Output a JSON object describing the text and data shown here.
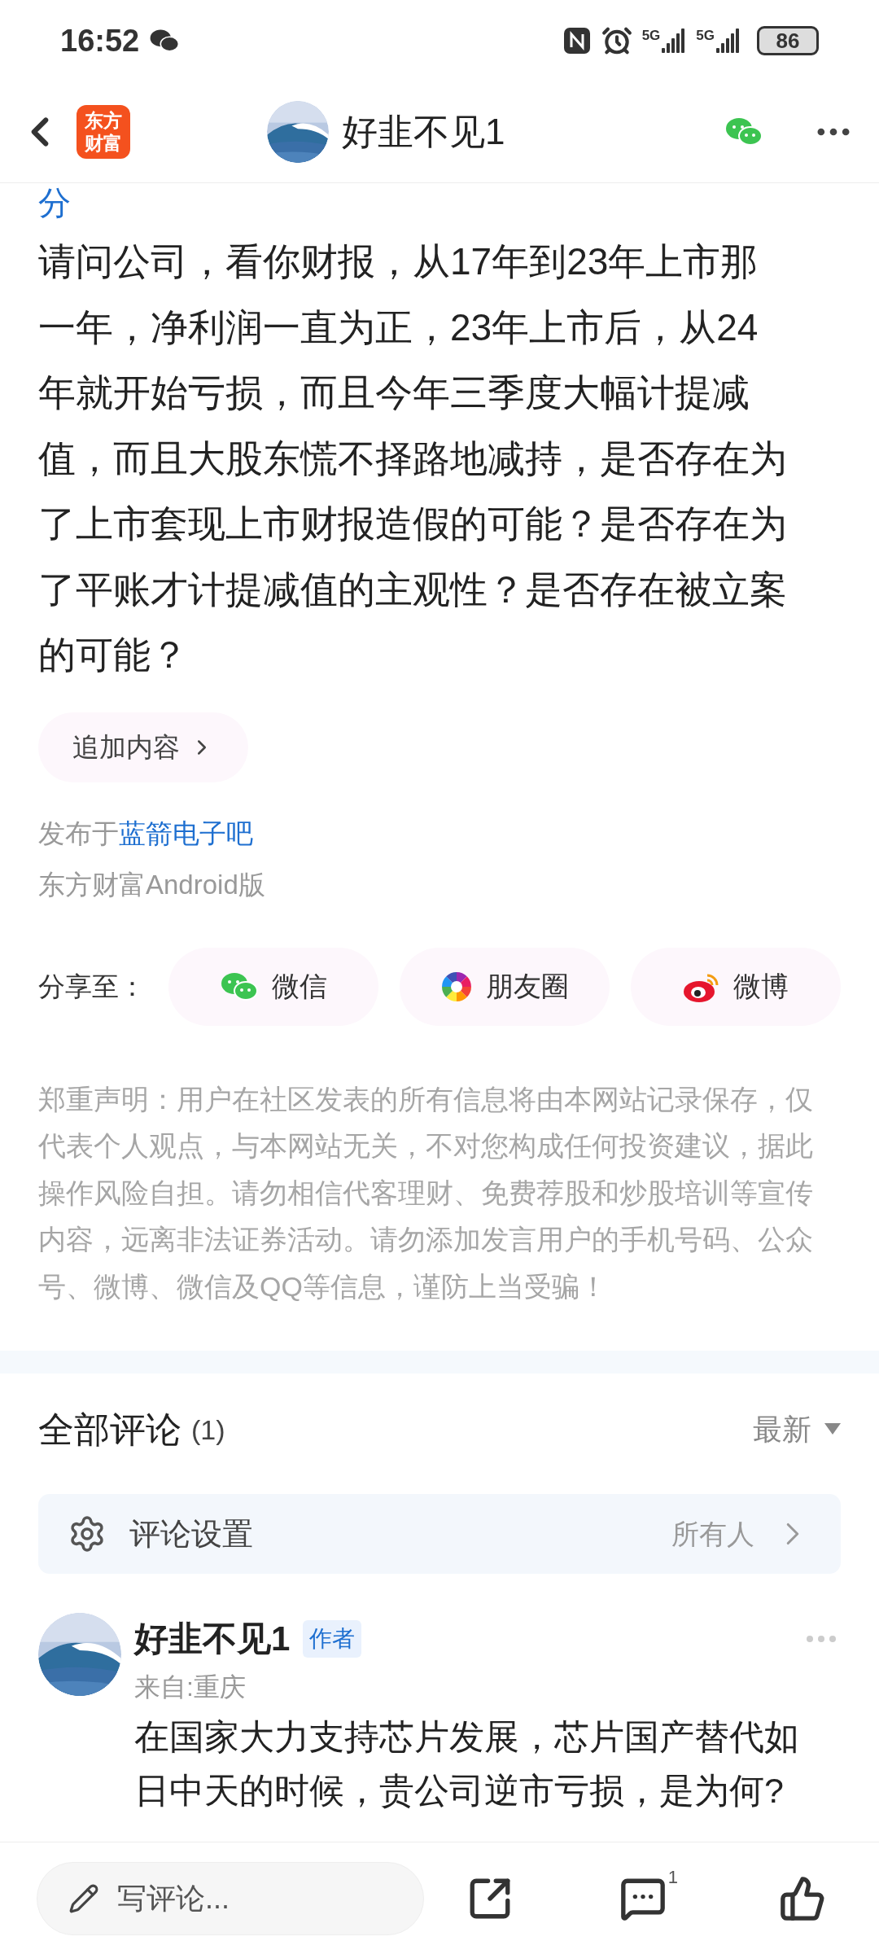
{
  "status_bar": {
    "time": "16:52",
    "battery": "86",
    "network_labels": [
      "5G",
      "5G"
    ]
  },
  "header": {
    "logo_lines": [
      "东方",
      "财富"
    ],
    "title": "好韭不见1"
  },
  "post": {
    "cut_top_text": "分",
    "body_lines": [
      "请问公司，看你财报，从17年到23年上市那",
      "一年，净利润一直为正，23年上市后，从24",
      "年就开始亏损，而且今年三季度大幅计提减",
      "值，而且大股东慌不择路地减持，是否存在为",
      "了上市套现上市财报造假的可能？是否存在为",
      "了平账才计提减值的主观性？是否存在被立案",
      "的可能？"
    ],
    "add_button": "追加内容",
    "published_prefix": "发布于",
    "forum_link": "蓝箭电子吧",
    "client": "东方财富Android版"
  },
  "share": {
    "label": "分享至：",
    "targets": [
      {
        "kind": "wechat",
        "label": "微信"
      },
      {
        "kind": "moments",
        "label": "朋友圈"
      },
      {
        "kind": "weibo",
        "label": "微博"
      }
    ]
  },
  "disclaimer_lines": [
    "郑重声明：用户在社区发表的所有信息将由本网站记录保存，仅",
    "代表个人观点，与本网站无关，不对您构成任何投资建议，据此",
    "操作风险自担。请勿相信代客理财、免费荐股和炒股培训等宣传",
    "内容，远离非法证券活动。请勿添加发言用户的手机号码、公众",
    "号、微博、微信及QQ等信息，谨防上当受骗！"
  ],
  "comments": {
    "title": "全部评论",
    "count": "(1)",
    "sort": "最新",
    "settings_label": "评论设置",
    "settings_value": "所有人",
    "items": [
      {
        "author": "好韭不见1",
        "badge": "作者",
        "location": "来自:重庆",
        "text_lines": [
          "在国家大力支持芯片发展，芯片国产替代如",
          "日中天的时候，贵公司逆市亏损，是为何?"
        ]
      }
    ]
  },
  "bottom_bar": {
    "placeholder": "写评论...",
    "comment_count": "1"
  }
}
